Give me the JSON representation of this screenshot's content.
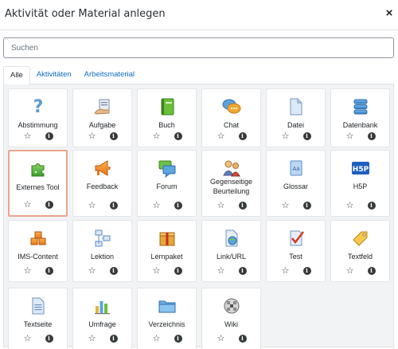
{
  "modal": {
    "title": "Aktivität oder Material anlegen",
    "close_glyph": "×"
  },
  "search": {
    "placeholder": "Suchen",
    "value": ""
  },
  "tabs": [
    {
      "label": "Alle",
      "active": true
    },
    {
      "label": "Aktivitäten",
      "active": false
    },
    {
      "label": "Arbeitsmaterial",
      "active": false
    }
  ],
  "tiles": [
    {
      "label": "Abstimmung",
      "icon": "question-icon"
    },
    {
      "label": "Aufgabe",
      "icon": "assignment-icon"
    },
    {
      "label": "Buch",
      "icon": "book-icon"
    },
    {
      "label": "Chat",
      "icon": "chat-icon"
    },
    {
      "label": "Datei",
      "icon": "file-icon"
    },
    {
      "label": "Datenbank",
      "icon": "database-icon"
    },
    {
      "label": "Externes Tool",
      "icon": "puzzle-icon",
      "selected": true
    },
    {
      "label": "Feedback",
      "icon": "megaphone-icon"
    },
    {
      "label": "Forum",
      "icon": "forum-icon"
    },
    {
      "label": "Gegenseitige Beurteilung",
      "icon": "workshop-icon"
    },
    {
      "label": "Glossar",
      "icon": "glossary-icon"
    },
    {
      "label": "H5P",
      "icon": "h5p-icon"
    },
    {
      "label": "IMS-Content",
      "icon": "ims-content-icon"
    },
    {
      "label": "Lektion",
      "icon": "lesson-icon"
    },
    {
      "label": "Lernpaket",
      "icon": "scorm-package-icon"
    },
    {
      "label": "Link/URL",
      "icon": "url-icon"
    },
    {
      "label": "Test",
      "icon": "quiz-icon"
    },
    {
      "label": "Textfeld",
      "icon": "label-icon"
    },
    {
      "label": "Textseite",
      "icon": "page-icon"
    },
    {
      "label": "Umfrage",
      "icon": "survey-icon"
    },
    {
      "label": "Verzeichnis",
      "icon": "folder-icon"
    },
    {
      "label": "Wiki",
      "icon": "wiki-icon"
    }
  ],
  "tile_actions": {
    "star_glyph": "☆",
    "info_glyph": "i"
  },
  "colors": {
    "link": "#0f6cbf",
    "selected_border": "#e9a58a",
    "panel_bg": "#f1f3f5"
  }
}
